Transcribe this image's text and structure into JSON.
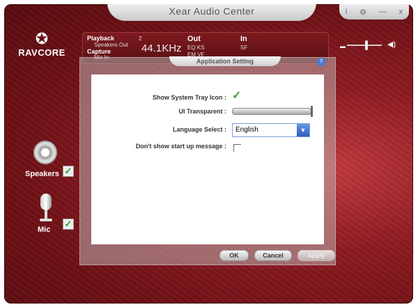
{
  "window": {
    "title": "Xear Audio Center"
  },
  "system_buttons": {
    "info": "i",
    "settings": "⚙",
    "minimize": "—",
    "close": "x"
  },
  "brand": {
    "name": "RAVCORE"
  },
  "info": {
    "playback_label": "Playback",
    "playback_channels": "2",
    "playback_device": "Speakers Out",
    "capture_label": "Capture",
    "capture_device": "Mic In",
    "sample_rate": "44.1KHz",
    "out_label": "Out",
    "out_items": "EQ  KS",
    "out_items2": "EM  VF",
    "in_label": "In",
    "in_items": "SF"
  },
  "devices": [
    {
      "label": "Speakers",
      "checked": true
    },
    {
      "label": "Mic",
      "checked": true
    }
  ],
  "dialog": {
    "title": "Application Setting",
    "settings": {
      "tray_icon_label": "Show System Tray Icon :",
      "tray_icon_checked": true,
      "transparent_label": "UI Transparent :",
      "transparent_level": 1.0,
      "language_label": "Language Select :",
      "language_value": "English",
      "startup_label": "Don't show start up message :",
      "startup_checked": false
    },
    "buttons": {
      "ok": "OK",
      "cancel": "Cancel",
      "apply": "Apply"
    }
  },
  "colors": {
    "accent": "#2c5fc0",
    "check": "#3aa63a",
    "background": "#8f1c22"
  }
}
